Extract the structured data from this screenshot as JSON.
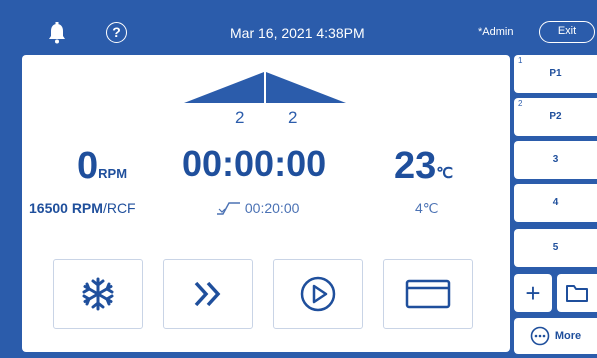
{
  "header": {
    "datetime": "Mar 16, 2021 4:38PM",
    "user": "*Admin",
    "exit_label": "Exit",
    "help_glyph": "?",
    "icons": [
      "bell-icon",
      "help-icon"
    ]
  },
  "main": {
    "accel_level": "2",
    "decel_level": "2",
    "speed": {
      "value": "0",
      "unit": "RPM"
    },
    "timer": "00:00:00",
    "temperature": {
      "value": "23",
      "unit": "℃"
    },
    "max_speed": "16500 RPM",
    "max_speed_sep": "/",
    "max_speed_mode": "RCF",
    "set_time": "00:20:00",
    "set_temp": "4℃",
    "buttons": [
      "snowflake-icon",
      "fast-forward-icon",
      "play-icon",
      "window-icon"
    ]
  },
  "programs": [
    {
      "index": "1",
      "label": "P1"
    },
    {
      "index": "2",
      "label": "P2"
    },
    {
      "index": "",
      "label": "3"
    },
    {
      "index": "",
      "label": "4"
    },
    {
      "index": "",
      "label": "5"
    }
  ],
  "side": {
    "add_glyph": "+",
    "more_label": "More"
  },
  "colors": {
    "background": "#2b5cab",
    "panel": "#ffffff",
    "accent": "#1f4f9c"
  }
}
